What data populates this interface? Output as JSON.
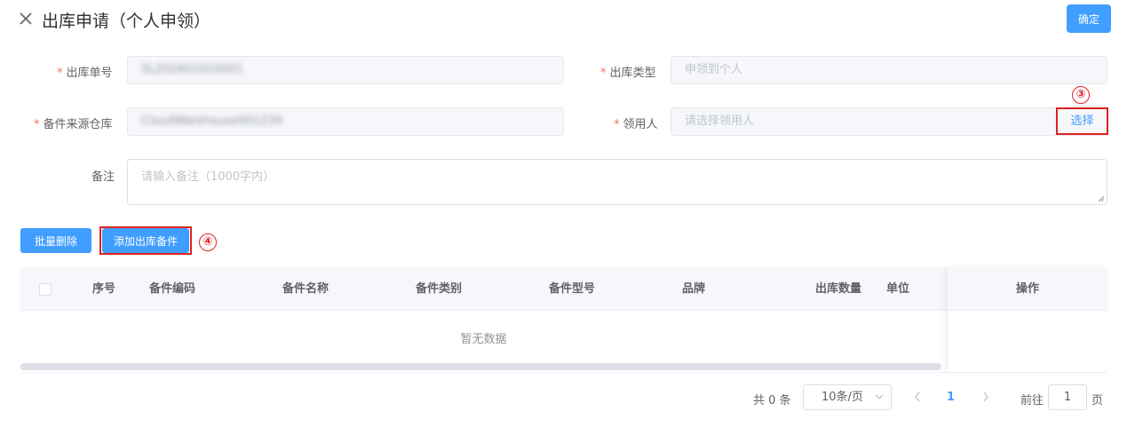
{
  "header": {
    "title": "出库申请（个人申领）",
    "confirm_label": "确定"
  },
  "form": {
    "order_no": {
      "label": "出库单号",
      "value": "SL202401010001"
    },
    "out_type": {
      "label": "出库类型",
      "placeholder": "申领到个人"
    },
    "source_warehouse": {
      "label": "备件来源仓库",
      "value": "CloudWarehouse001234"
    },
    "recipient": {
      "label": "领用人",
      "placeholder": "请选择领用人",
      "select_label": "选择"
    },
    "remark": {
      "label": "备注",
      "placeholder": "请输入备注（1000字内）"
    }
  },
  "annotations": {
    "step3": "③",
    "step4": "④"
  },
  "actions": {
    "batch_delete_label": "批量删除",
    "add_parts_label": "添加出库备件"
  },
  "table": {
    "columns": [
      "序号",
      "备件编码",
      "备件名称",
      "备件类别",
      "备件型号",
      "品牌",
      "出库数量",
      "单位",
      "操作"
    ],
    "empty_text": "暂无数据"
  },
  "pagination": {
    "total_text": "共 0 条",
    "page_size": "10条/页",
    "current_page": "1",
    "goto_label": "前往",
    "goto_value": "1",
    "page_suffix": "页"
  },
  "colors": {
    "primary": "#409eff",
    "required": "#f56c6c",
    "highlight": "#e02020"
  }
}
